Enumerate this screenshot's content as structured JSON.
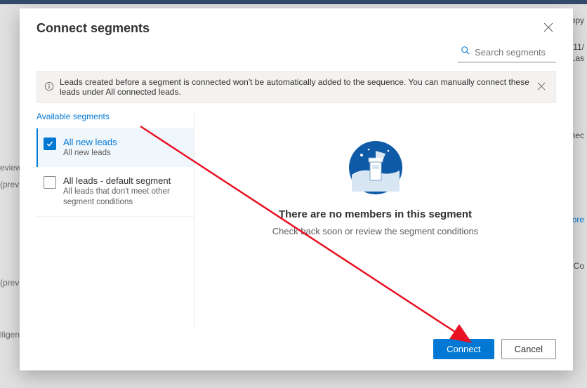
{
  "dialog": {
    "title": "Connect segments",
    "search": {
      "placeholder": "Search segments"
    },
    "info": {
      "message": "Leads created before a segment is connected won't be automatically added to the sequence. You can manually connect these leads under All connected leads."
    },
    "left": {
      "heading": "Available segments",
      "items": [
        {
          "title": "All new leads",
          "subtitle": "All new leads",
          "selected": true
        },
        {
          "title": "All leads - default segment",
          "subtitle": "All leads that don't meet other segment conditions",
          "selected": false
        }
      ]
    },
    "empty": {
      "title": "There are no members in this segment",
      "subtitle": "Check back soon or review the segment conditions"
    },
    "footer": {
      "connect": "Connect",
      "cancel": "Cancel"
    }
  },
  "background": {
    "left_nav": [
      "eview)",
      "(previ",
      "(previ",
      "lligenc"
    ],
    "right_col": [
      "copy",
      "11/",
      "Las",
      "onnec",
      "ore",
      "Co"
    ]
  }
}
